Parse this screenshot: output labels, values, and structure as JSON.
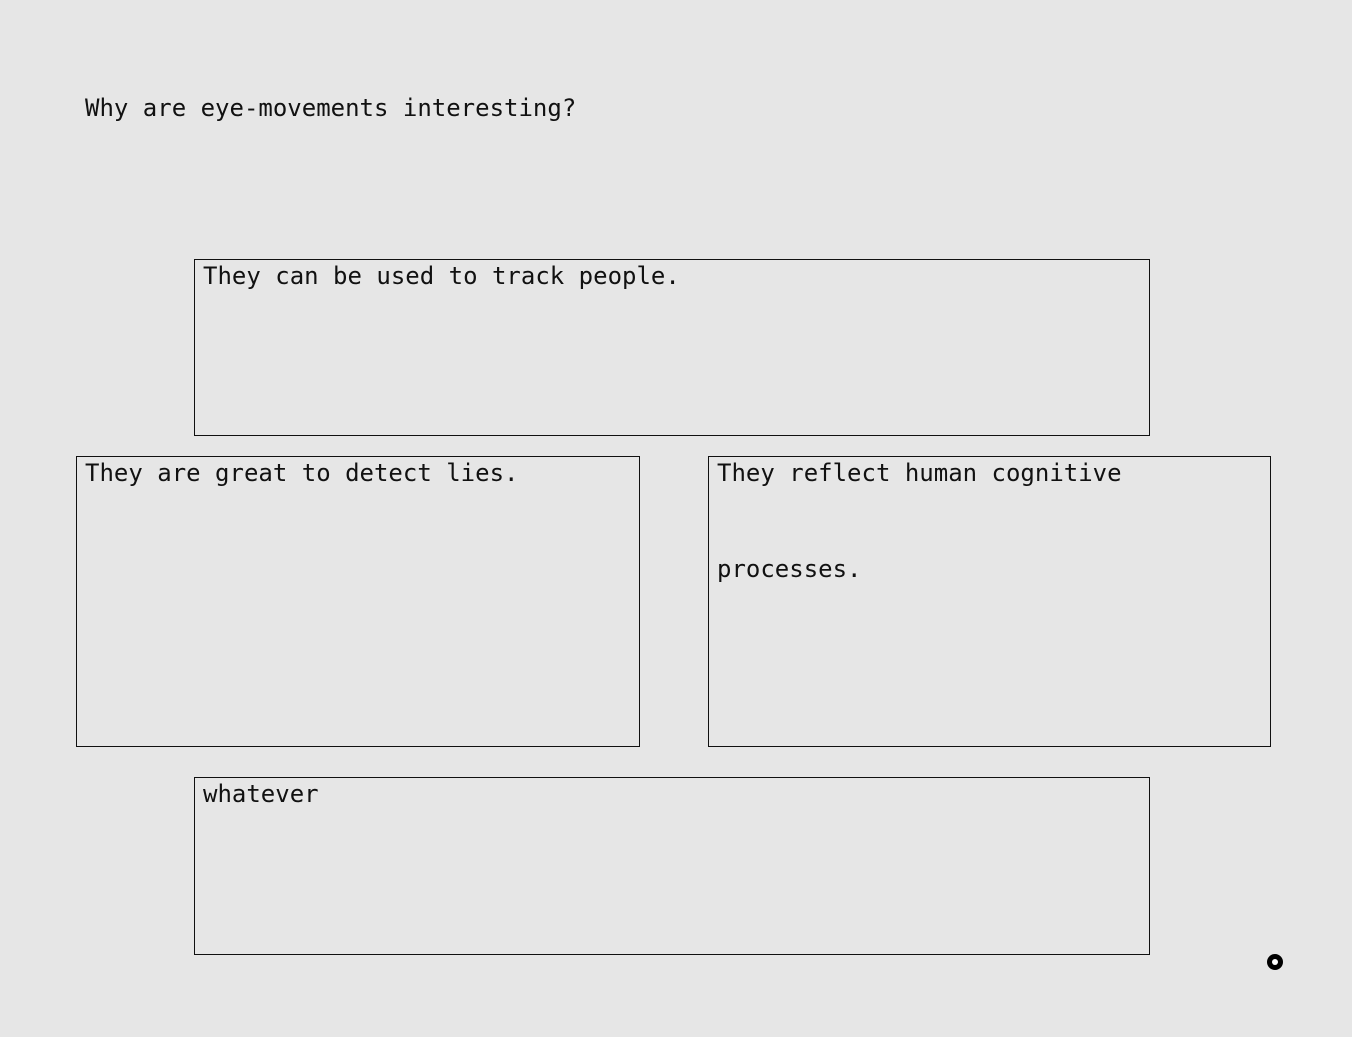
{
  "question": "Why are eye-movements interesting?",
  "answers": [
    {
      "label": "They can be used to track people."
    },
    {
      "label": "They are great to detect lies."
    },
    {
      "label": "They reflect human cognitive processes."
    },
    {
      "label": "whatever"
    }
  ],
  "cursor": {
    "icon": "gaze-cursor-icon"
  },
  "colors": {
    "background": "#e6e6e6",
    "border": "#111111",
    "text": "#111111"
  }
}
